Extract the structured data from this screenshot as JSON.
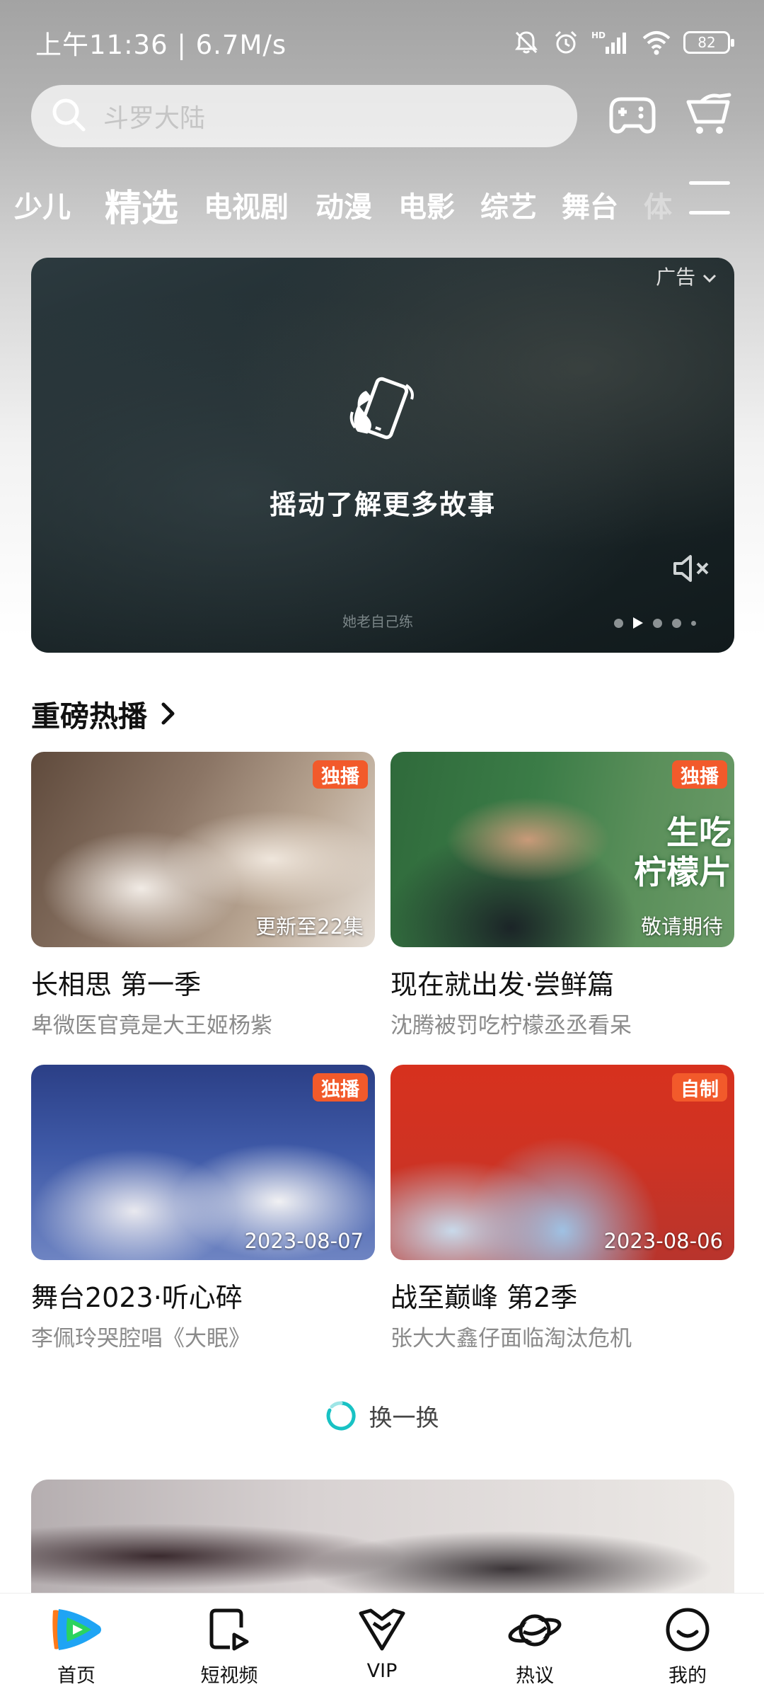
{
  "status_bar": {
    "time_speed": "上午11:36 | 6.7M/s",
    "battery": "82",
    "network": "HD"
  },
  "search": {
    "placeholder": "斗罗大陆"
  },
  "tabs": [
    "少儿",
    "精选",
    "电视剧",
    "动漫",
    "电影",
    "综艺",
    "舞台",
    "体"
  ],
  "active_tab": "精选",
  "banner": {
    "ad_label": "广告",
    "shake_text": "摇动了解更多故事",
    "watermark": "她老自己练"
  },
  "section": {
    "title": "重磅热播"
  },
  "cards": [
    {
      "tag": "独播",
      "caption": "更新至22集",
      "title": "长相思 第一季",
      "subtitle": "卑微医官竟是大王姬杨紫"
    },
    {
      "tag": "独播",
      "caption": "敬请期待",
      "title": "现在就出发·尝鲜篇",
      "subtitle": "沈腾被罚吃柠檬丞丞看呆",
      "overlay": "生吃\n柠檬片"
    },
    {
      "tag": "独播",
      "caption": "2023-08-07",
      "title": "舞台2023·听心碎",
      "subtitle": "李佩玲哭腔唱《大眠》"
    },
    {
      "tag": "自制",
      "caption": "2023-08-06",
      "title": "战至巅峰 第2季",
      "subtitle": "张大大鑫仔面临淘汰危机"
    }
  ],
  "refresh_label": "换一换",
  "bottom_nav": [
    {
      "label": "首页",
      "icon": "tencent-video-logo-icon"
    },
    {
      "label": "短视频",
      "icon": "short-video-icon"
    },
    {
      "label": "VIP",
      "icon": "vip-crown-icon"
    },
    {
      "label": "热议",
      "icon": "planet-icon"
    },
    {
      "label": "我的",
      "icon": "smiley-profile-icon"
    }
  ],
  "colors": {
    "tag_orange": "#f25a2b",
    "refresh_accent": "#18c2c4",
    "logo_blue": "#1fa4f4",
    "logo_orange": "#ff7a1a",
    "logo_green": "#2bd35f"
  }
}
